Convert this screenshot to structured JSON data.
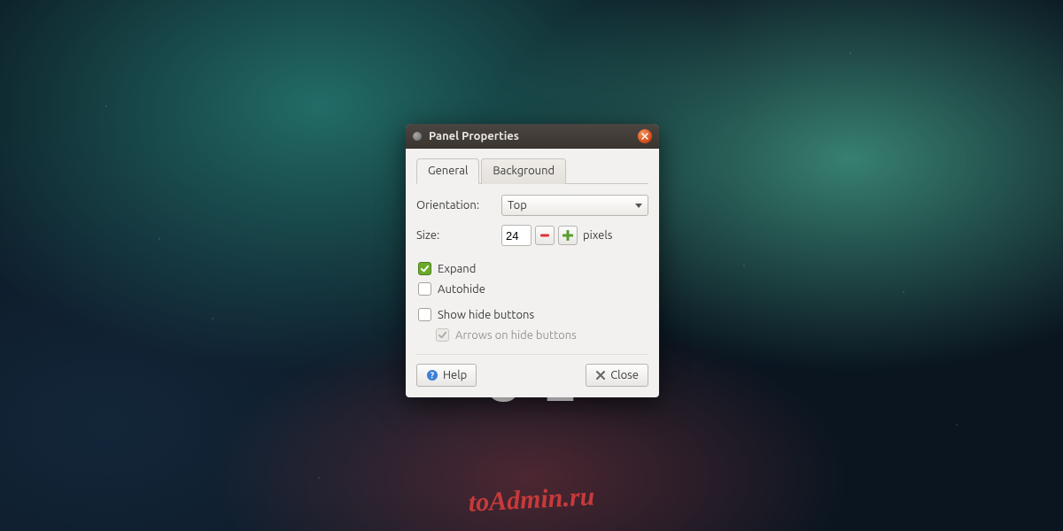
{
  "background": {
    "text": "U                           E",
    "watermark": "toAdmin.ru"
  },
  "dialog": {
    "title": "Panel Properties",
    "tabs": {
      "general": "General",
      "background": "Background"
    },
    "fields": {
      "orientation_label": "Orientation:",
      "orientation_value": "Top",
      "size_label": "Size:",
      "size_value": "24",
      "size_unit": "pixels"
    },
    "checks": {
      "expand": "Expand",
      "autohide": "Autohide",
      "show_hide_buttons": "Show hide buttons",
      "arrows": "Arrows on hide buttons"
    },
    "buttons": {
      "help": "Help",
      "close": "Close"
    }
  }
}
